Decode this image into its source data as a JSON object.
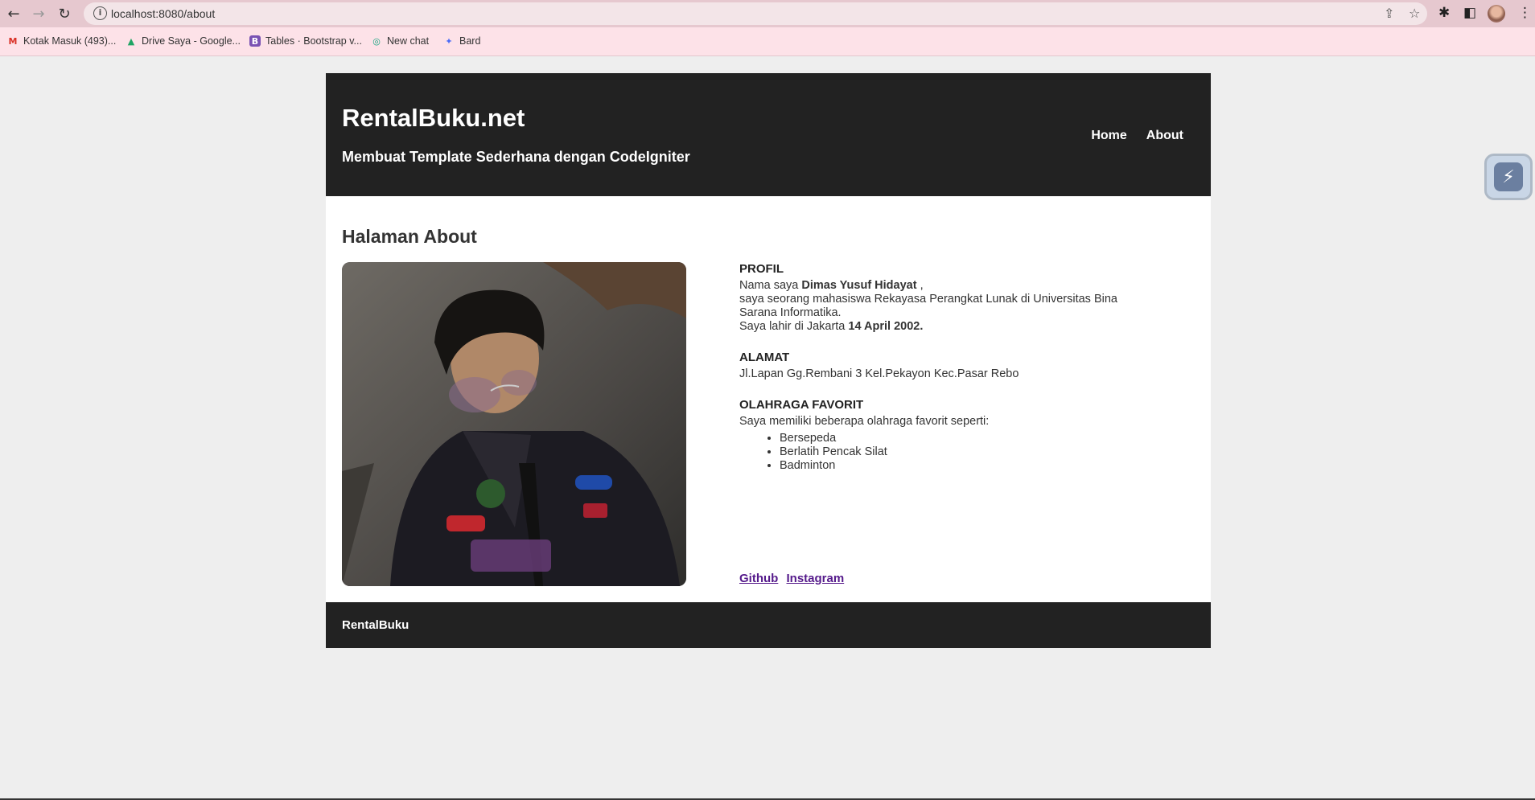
{
  "browser": {
    "url": "localhost:8080/about",
    "back_icon": "←",
    "forward_icon": "→",
    "reload_icon": "↻",
    "info_icon": "i",
    "share_icon": "⇪",
    "star_icon": "☆",
    "extensions_icon": "✱",
    "sidepanel_icon": "◧",
    "menu_icon": "⋮"
  },
  "bookmarks": [
    {
      "label": "Kotak Masuk (493)...",
      "icon": "M",
      "icon_color": "#d93025"
    },
    {
      "label": "Drive Saya - Google...",
      "icon": "▲",
      "icon_color": "#1fa463"
    },
    {
      "label": "Tables · Bootstrap v...",
      "icon": "B",
      "icon_color": "#7952b3"
    },
    {
      "label": "New chat",
      "icon": "◎",
      "icon_color": "#10a37f"
    },
    {
      "label": "Bard",
      "icon": "✦",
      "icon_color": "#4b6cf7"
    }
  ],
  "header": {
    "title": "RentalBuku.net",
    "tagline": "Membuat Template Sederhana dengan CodeIgniter",
    "nav": [
      "Home",
      "About"
    ]
  },
  "main": {
    "heading": "Halaman About",
    "profil": {
      "heading": "PROFIL",
      "line1_prefix": "Nama saya ",
      "name": "Dimas Yusuf Hidayat",
      "line1_suffix": " ,",
      "line2": "saya seorang mahasiswa Rekayasa Perangkat Lunak di Universitas Bina Sarana Informatika.",
      "line3_prefix": "Saya lahir di Jakarta ",
      "birthdate": "14 April 2002."
    },
    "alamat": {
      "heading": "ALAMAT",
      "text": "Jl.Lapan Gg.Rembani 3 Kel.Pekayon Kec.Pasar Rebo"
    },
    "olahraga": {
      "heading": "OLAHRAGA FAVORIT",
      "intro": "Saya memiliki beberapa olahraga favorit seperti:",
      "items": [
        "Bersepeda",
        "Berlatih Pencak Silat",
        "Badminton"
      ]
    },
    "links": [
      "Github",
      "Instagram"
    ]
  },
  "footer": {
    "text": "RentalBuku"
  },
  "colors": {
    "header_bg": "#222222",
    "page_bg": "#eeeeee",
    "chrome_bg": "#e6c8cf",
    "link_visited": "#551a8b"
  }
}
